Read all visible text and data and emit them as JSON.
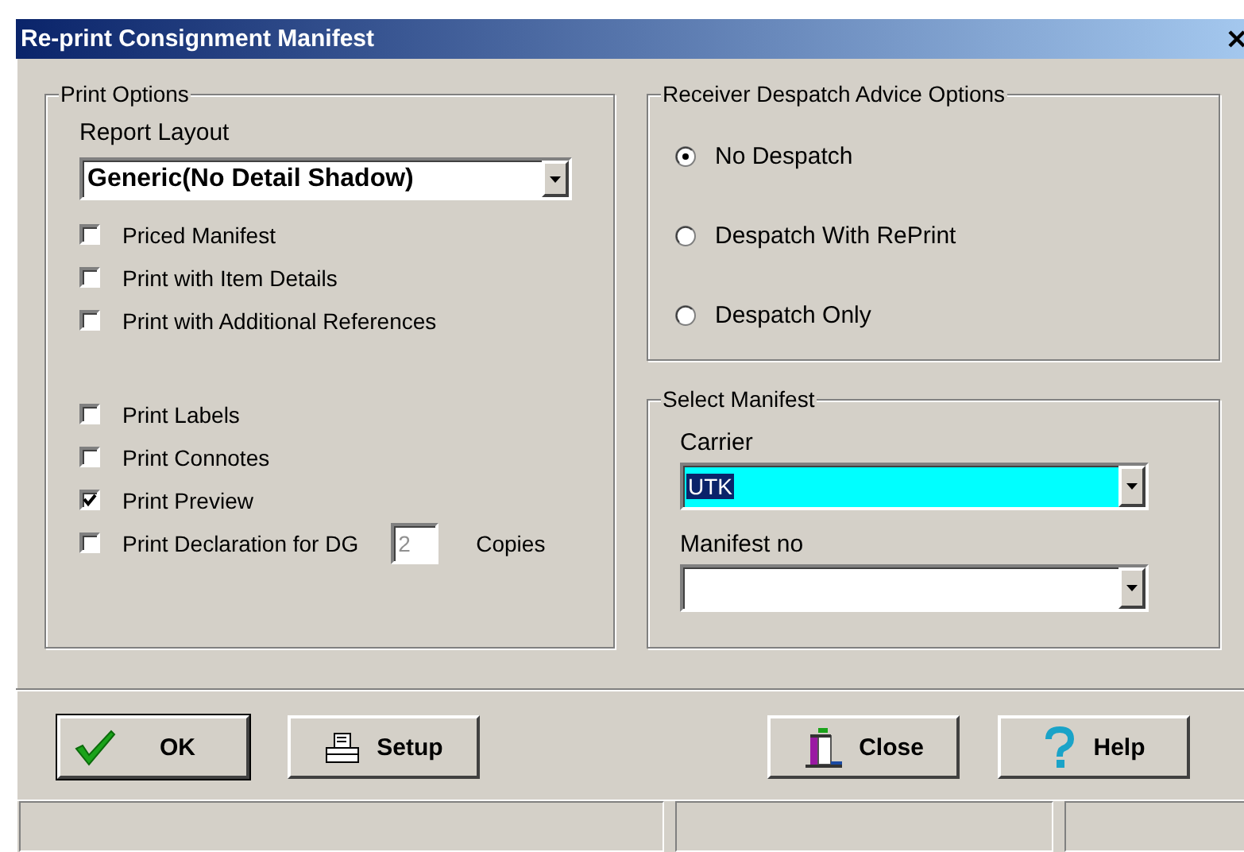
{
  "window": {
    "title": "Re-print Consignment Manifest"
  },
  "print_options": {
    "title": "Print Options",
    "report_layout": {
      "label": "Report Layout",
      "value": "Generic(No Detail Shadow)"
    },
    "option_groups": [
      {
        "options": [
          {
            "kind": "plain",
            "label": "Priced Manifest",
            "checked": false
          },
          {
            "kind": "plain",
            "label": "Print with Item Details",
            "checked": false
          },
          {
            "kind": "plain",
            "label": "Print with Additional References",
            "checked": false
          }
        ]
      },
      {
        "options": [
          {
            "kind": "plain",
            "label": "Print Labels",
            "checked": false
          },
          {
            "kind": "plain",
            "label": "Print Connotes",
            "checked": false
          },
          {
            "kind": "plain",
            "label": "Print Preview",
            "checked": true
          },
          {
            "kind": "copies",
            "label": "Print Declaration for DG",
            "checked": false,
            "copies": {
              "value": "2",
              "disabled": true
            },
            "suffix": "Copies"
          }
        ]
      }
    ]
  },
  "despatch_options": {
    "title": "Receiver Despatch Advice Options",
    "options": [
      {
        "label": "No Despatch",
        "selected": true
      },
      {
        "label": "Despatch With RePrint",
        "selected": false
      },
      {
        "label": "Despatch Only",
        "selected": false
      }
    ]
  },
  "select_manifest": {
    "title": "Select Manifest",
    "fields": [
      {
        "label": "Carrier",
        "value": "UTK",
        "highlighted": true
      },
      {
        "label": "Manifest no",
        "highlighted": false
      }
    ]
  },
  "buttons": [
    {
      "kind": "ok",
      "label": "OK",
      "default": true
    },
    {
      "kind": "setup",
      "label": "Setup",
      "default": false
    },
    {
      "kind": "close",
      "label": "Close",
      "default": false
    },
    {
      "kind": "help",
      "label": "Help",
      "default": false
    }
  ]
}
